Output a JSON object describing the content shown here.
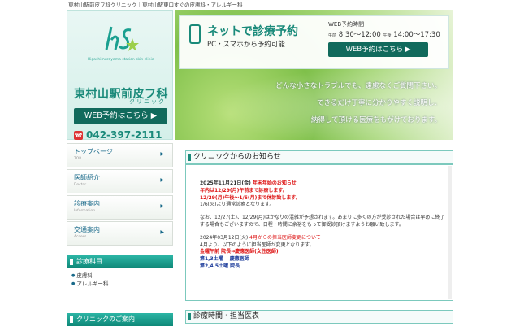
{
  "header": {
    "tagline": "東村山駅前皮フ科クリニック｜東村山駅東口すぐの皮膚科・アレルギー科"
  },
  "brand": {
    "logo_sub": "Higashimurayama station skin clinic",
    "name": "東村山駅前皮フ科",
    "name_sub": "クリニック",
    "web_button": "WEB予約はこちら ▶",
    "phone": "042-397-2111",
    "phone_icon": "phone-icon"
  },
  "hero": {
    "title": "ネットで診療予約",
    "subtitle": "PC・スマホから予約可能",
    "hours_title": "WEB予約時間",
    "hours_am_label": "午前",
    "hours_am": "8:30〜12:00",
    "hours_pm_label": "午後",
    "hours_pm": "14:00〜17:30",
    "web_button": "WEB予約はこちら ▶",
    "lines": [
      "どんな小さなトラブルでも、遠慮なくご質問下さい。",
      "できるだけ丁寧に分かりやすく説明し、",
      "納得して頂ける医療をもがけております。"
    ]
  },
  "nav": [
    {
      "label": "トップページ",
      "sub": "TOP"
    },
    {
      "label": "医師紹介",
      "sub": "Doctor"
    },
    {
      "label": "診療案内",
      "sub": "Information"
    },
    {
      "label": "交通案内",
      "sub": "Access"
    }
  ],
  "sidebar": {
    "departments_title": "診療科目",
    "departments": [
      "皮膚科",
      "アレルギー科"
    ],
    "clinic_title": "クリニックのご案内"
  },
  "news": {
    "title": "クリニックからのお知らせ",
    "date1": "2025年11月21日(金)",
    "head1": "年末年始のお知らせ",
    "l1": "年内は12/29(月)午前まで診療します。",
    "l2": "12/29(月)午後〜1/5(月)まで休診致します。",
    "l3": "1/6(火)より通常診療となります。",
    "l4": "なお、12/27(土)、12/29(月)はかなりの混雑が予想されます。あまりに多くの方が受診された場合は早めに終了する場合もございますので、日程・時間に余裕をもって御受診頂けますようお願い致します。",
    "date2": "2024年03月12日(火)",
    "head2": "4月からの担当医師変更について",
    "l5": "4月より、以下のように担当医師が変更となります。",
    "l6": "金曜午前 院長→慶應医師(女性医師)",
    "l7": "第1,3土曜　 慶應医師",
    "l8": "第2,4,5土曜 院長"
  },
  "hours_section": {
    "title": "診療時間・担当医表"
  }
}
